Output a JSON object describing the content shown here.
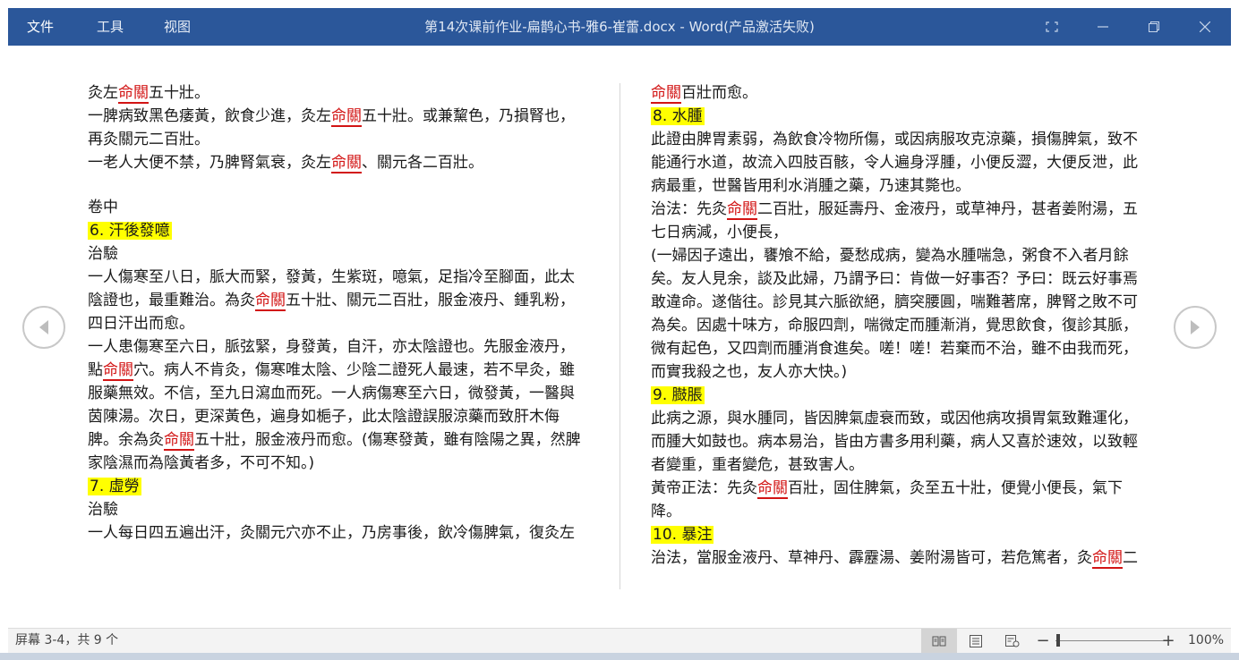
{
  "titlebar": {
    "menus": [
      "文件",
      "工具",
      "视图"
    ],
    "title": "第14次课前作业-扁鹊心书-雅6-崔蕾.docx - Word(产品激活失败)"
  },
  "left": {
    "l1a": "灸左",
    "l1b": "命關",
    "l1c": "五十壯。",
    "l2a": "一脾病致黑色痿黃，飲食少進，灸左",
    "l2b": "命關",
    "l2c": "五十壯。或兼黧色，乃損腎也，再灸關元二百壯。",
    "l3a": "一老人大便不禁，乃脾腎氣衰，灸左",
    "l3b": "命關",
    "l3c": "、關元各二百壯。",
    "vol": "卷中",
    "h6": "6. 汗後發噫",
    "zy1": "治驗",
    "c1a": "一人傷寒至八日，脈大而緊，發黃，生紫斑，噫氣，足指冷至腳面，此太陰證也，最重難治。為灸",
    "c1b": "命關",
    "c1c": "五十壯、關元二百壯，服金液丹、鍾乳粉，四日汗出而愈。",
    "c2a": "一人患傷寒至六日，脈弦緊，身發黃，自汗，亦太陰證也。先服金液丹，點",
    "c2b": "命關",
    "c2c": "穴。病人不肯灸，傷寒唯太陰、少陰二證死人最速，若不早灸，雖服藥無效。不信，至九日瀉血而死。一人病傷寒至六日，微發黃，一醫與茵陳湯。次日，更深黃色，遍身如梔子，此太陰證誤服涼藥而致肝木侮脾。余為灸",
    "c2d": "命關",
    "c2e": "五十壯，服金液丹而愈。(傷寒發黃，雖有陰陽之異，然脾家陰濕而為陰黃者多，不可不知。)",
    "h7": "7. 虛勞",
    "zy2": "治驗",
    "c3": "一人每日四五遍出汗，灸關元穴亦不止，乃房事後，飲冷傷脾氣，復灸左"
  },
  "right": {
    "r1a": "命關",
    "r1b": "百壯而愈。",
    "h8": "8. 水腫",
    "r2": "此證由脾胃素弱，為飲食冷物所傷，或因病服攻克涼藥，損傷脾氣，致不能通行水道，故流入四肢百骸，令人遍身浮腫，小便反澀，大便反泄，此病最重，世醫皆用利水消腫之藥，乃速其斃也。",
    "r3a": "治法：先灸",
    "r3b": "命關",
    "r3c": "二百壯，服延壽丹、金液丹，或草神丹，甚者姜附湯，五七日病減，小便長，",
    "r4": "(一婦因子遠出，饔飧不給，憂愁成病，變為水腫喘急，粥食不入者月餘矣。友人見余，談及此婦，乃謂予曰：肯做一好事否？予曰：既云好事焉敢違命。遂偕往。診見其六脈欲絕，臍突腰圓，喘難著席，脾腎之敗不可為矣。因處十味方，命服四劑，喘微定而腫漸消，覺思飲食，復診其脈，微有起色，又四劑而腫消食進矣。嗟！嗟！若棄而不治，雖不由我而死，而實我殺之也，友人亦大快。)",
    "h9": "9. 臌脹",
    "r5": "此病之源，與水腫同，皆因脾氣虛衰而致，或因他病攻損胃氣致難運化，而腫大如鼓也。病本易治，皆由方書多用利藥，病人又喜於速效，以致輕者變重，重者變危，甚致害人。",
    "r6a": "黃帝正法：先灸",
    "r6b": "命關",
    "r6c": "百壯，固住脾氣，灸至五十壯，便覺小便長，氣下降。",
    "h10": "10. 暴注",
    "r7a": "治法，當服金液丹、草神丹、霹靂湯、姜附湯皆可，若危篤者，灸",
    "r7b": "命關",
    "r7c": "二"
  },
  "statusbar": {
    "page_info": "屏幕 3-4，共 9 个",
    "zoom": "100%"
  },
  "colors": {
    "titlebar": "#2b579a",
    "highlight": "#ffff00",
    "spell": "#d21414"
  },
  "icons": [
    "minimize-icon",
    "restore-icon",
    "close-icon",
    "focus-icon",
    "prev-page-icon",
    "next-page-icon",
    "read-mode-icon",
    "print-layout-icon",
    "web-layout-icon"
  ]
}
